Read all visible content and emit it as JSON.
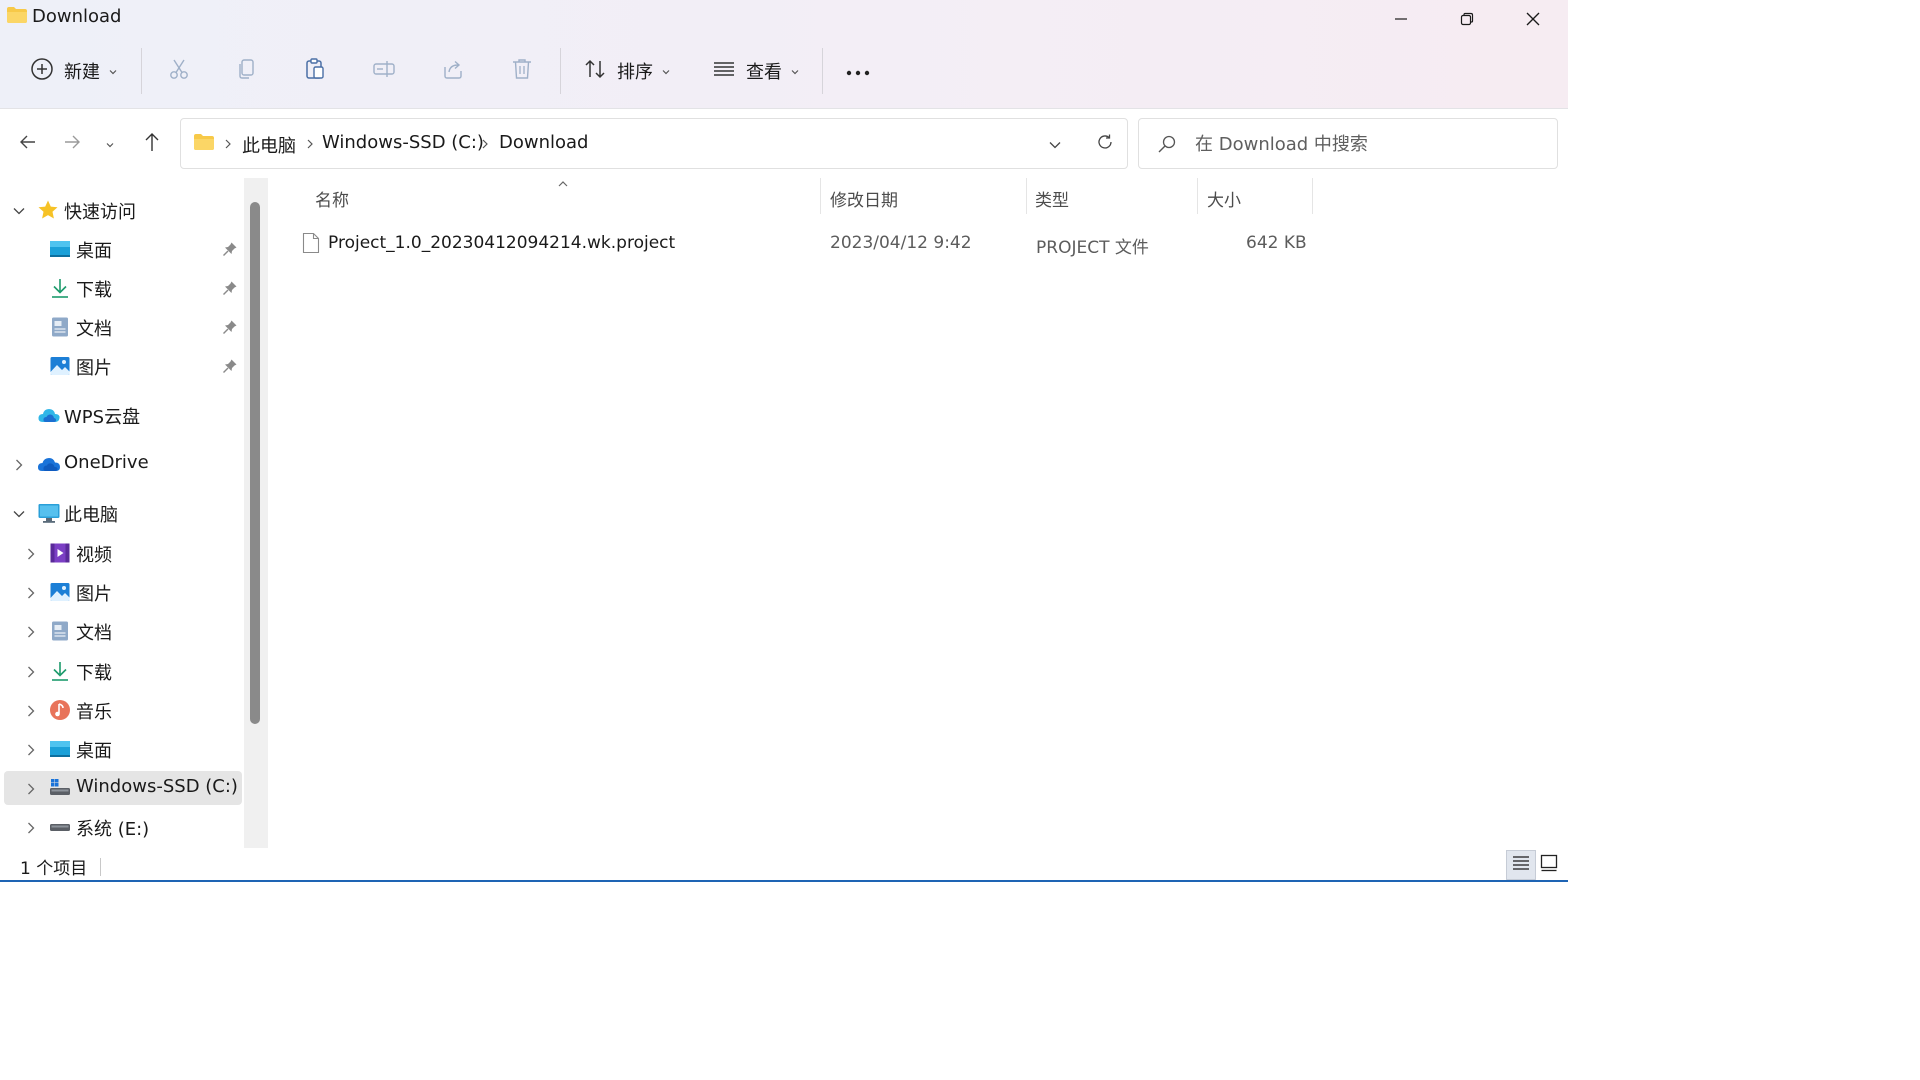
{
  "window": {
    "title": "Download",
    "controls": [
      "minimize",
      "restore",
      "close"
    ]
  },
  "toolbar": {
    "new_label": "新建",
    "sort_label": "排序",
    "view_label": "查看",
    "icons": [
      "cut-icon",
      "copy-icon",
      "paste-icon",
      "rename-icon",
      "share-icon",
      "delete-icon",
      "more-icon"
    ]
  },
  "address": {
    "crumbs": [
      "此电脑",
      "Windows-SSD (C:)",
      "Download"
    ]
  },
  "search": {
    "placeholder": "在 Download 中搜索"
  },
  "sidebar": {
    "quick_access": {
      "label": "快速访问",
      "items": [
        {
          "label": "桌面",
          "icon": "desktop-icon",
          "pinned": true
        },
        {
          "label": "下载",
          "icon": "download-icon",
          "pinned": true
        },
        {
          "label": "文档",
          "icon": "document-icon",
          "pinned": true
        },
        {
          "label": "图片",
          "icon": "pictures-icon",
          "pinned": true
        }
      ]
    },
    "wps": {
      "label": "WPS云盘",
      "icon": "wps-cloud-icon"
    },
    "onedrive": {
      "label": "OneDrive",
      "icon": "onedrive-icon"
    },
    "this_pc": {
      "label": "此电脑",
      "items": [
        {
          "label": "视频",
          "icon": "videos-icon"
        },
        {
          "label": "图片",
          "icon": "pictures-icon"
        },
        {
          "label": "文档",
          "icon": "document-icon"
        },
        {
          "label": "下载",
          "icon": "download-icon"
        },
        {
          "label": "音乐",
          "icon": "music-icon"
        },
        {
          "label": "桌面",
          "icon": "desktop-icon"
        },
        {
          "label": "Windows-SSD (C:)",
          "icon": "drive-c-icon",
          "selected": true
        },
        {
          "label": "系统 (E:)",
          "icon": "drive-e-icon"
        }
      ]
    }
  },
  "file_list": {
    "columns": [
      "名称",
      "修改日期",
      "类型",
      "大小"
    ],
    "sort_column": "名称",
    "rows": [
      {
        "name": "Project_1.0_20230412094214.wk.project",
        "modified": "2023/04/12 9:42",
        "type": "PROJECT 文件",
        "size": "642 KB"
      }
    ]
  },
  "status": {
    "item_count": "1 个项目",
    "view_modes": [
      "details",
      "tiles"
    ],
    "active_view": "details"
  },
  "colors": {
    "accent": "#1e64b4",
    "folder": "#f7c948",
    "selected_bg": "#e5e5e5"
  }
}
